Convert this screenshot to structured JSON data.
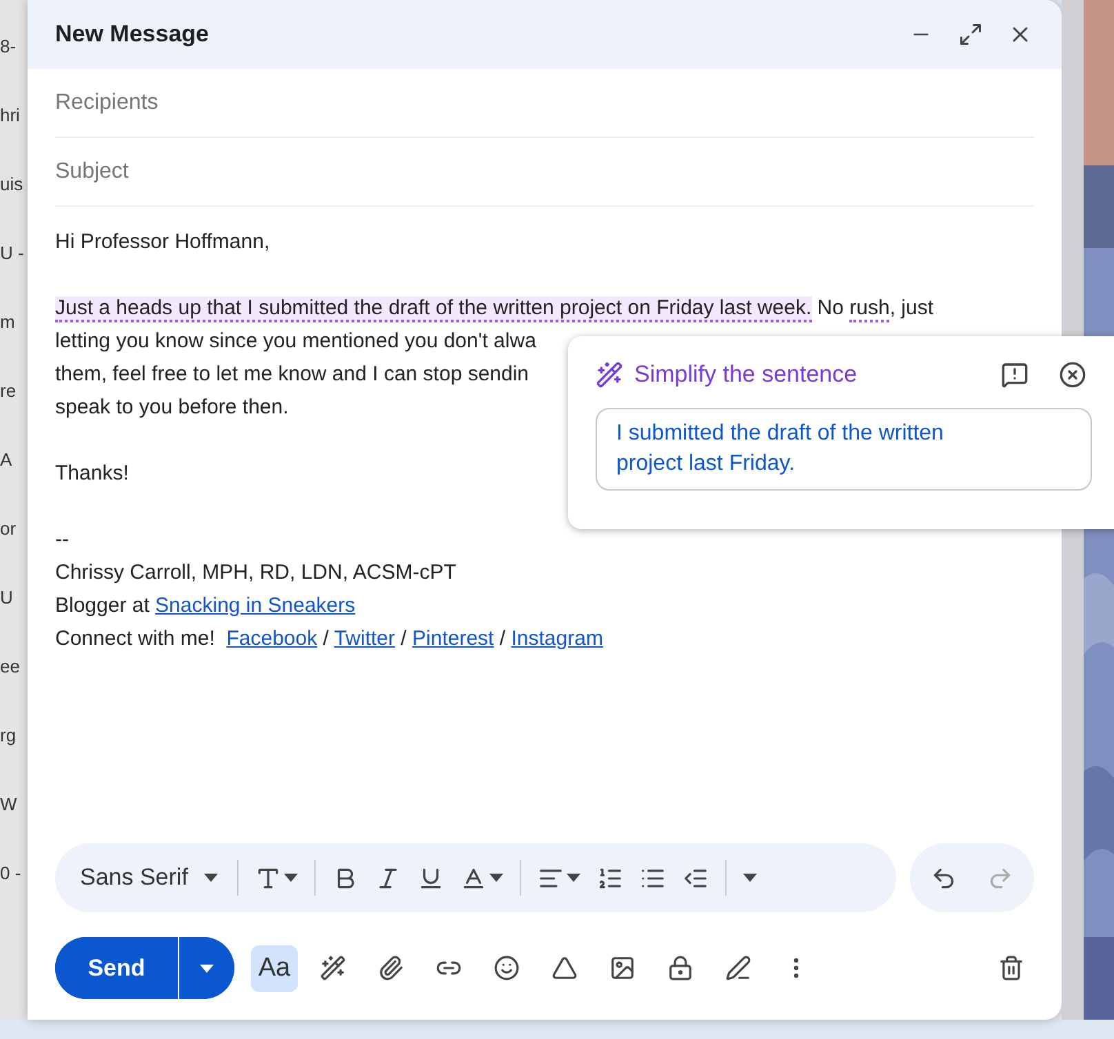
{
  "background_list": {
    "fragments": [
      "8-",
      "hri",
      "uis",
      "U -",
      "m",
      "re",
      "A",
      "or",
      "U",
      "ee",
      "rg",
      "W",
      "0 -"
    ]
  },
  "compose": {
    "title": "New Message"
  },
  "fields": [
    {
      "placeholder": "Recipients"
    },
    {
      "placeholder": "Subject"
    }
  ],
  "body": {
    "paragraphs": [
      {
        "lines": [
          [
            {
              "text": "Hi Professor Hoffmann,",
              "kind": "plain"
            }
          ]
        ]
      },
      {
        "lines": [
          [
            {
              "text": "Just a heads up that I submitted the draft of the written project on Friday last week.",
              "kind": "highlighted"
            },
            {
              "text": " No ",
              "kind": "plain"
            },
            {
              "text": "rush",
              "kind": "flagged"
            },
            {
              "text": ", just",
              "kind": "plain"
            }
          ],
          [
            {
              "text": "letting you know since you mentioned you don't alwa",
              "kind": "plain"
            }
          ],
          [
            {
              "text": "them, feel free to let me know and I can stop sendin",
              "kind": "plain"
            }
          ],
          [
            {
              "text": "speak to you before then.",
              "kind": "plain"
            }
          ]
        ]
      },
      {
        "lines": [
          [
            {
              "text": "Thanks!",
              "kind": "plain"
            }
          ]
        ]
      },
      {
        "lines": [
          [
            {
              "text": "--",
              "kind": "plain"
            }
          ],
          [
            {
              "text": "Chrissy Carroll, MPH, RD, LDN, ACSM-cPT",
              "kind": "plain"
            }
          ],
          [
            {
              "text": "Blogger at ",
              "kind": "plain"
            },
            {
              "text": "Snacking in Sneakers",
              "kind": "link"
            }
          ],
          [
            {
              "text": "Connect with me!  ",
              "kind": "plain"
            },
            {
              "text": "Facebook",
              "kind": "link"
            },
            {
              "text": " / ",
              "kind": "plain"
            },
            {
              "text": "Twitter",
              "kind": "link"
            },
            {
              "text": " / ",
              "kind": "plain"
            },
            {
              "text": "Pinterest",
              "kind": "link"
            },
            {
              "text": " / ",
              "kind": "plain"
            },
            {
              "text": "Instagram",
              "kind": "link"
            }
          ]
        ]
      }
    ]
  },
  "suggestion_popup": {
    "title": "Simplify the sentence",
    "suggestion": "I submitted the draft of the written project last Friday."
  },
  "format_toolbar": {
    "font": "Sans Serif"
  },
  "action_bar": {
    "send": "Send",
    "formatting_toggle": {
      "label": "Aa",
      "selected": true
    }
  }
}
